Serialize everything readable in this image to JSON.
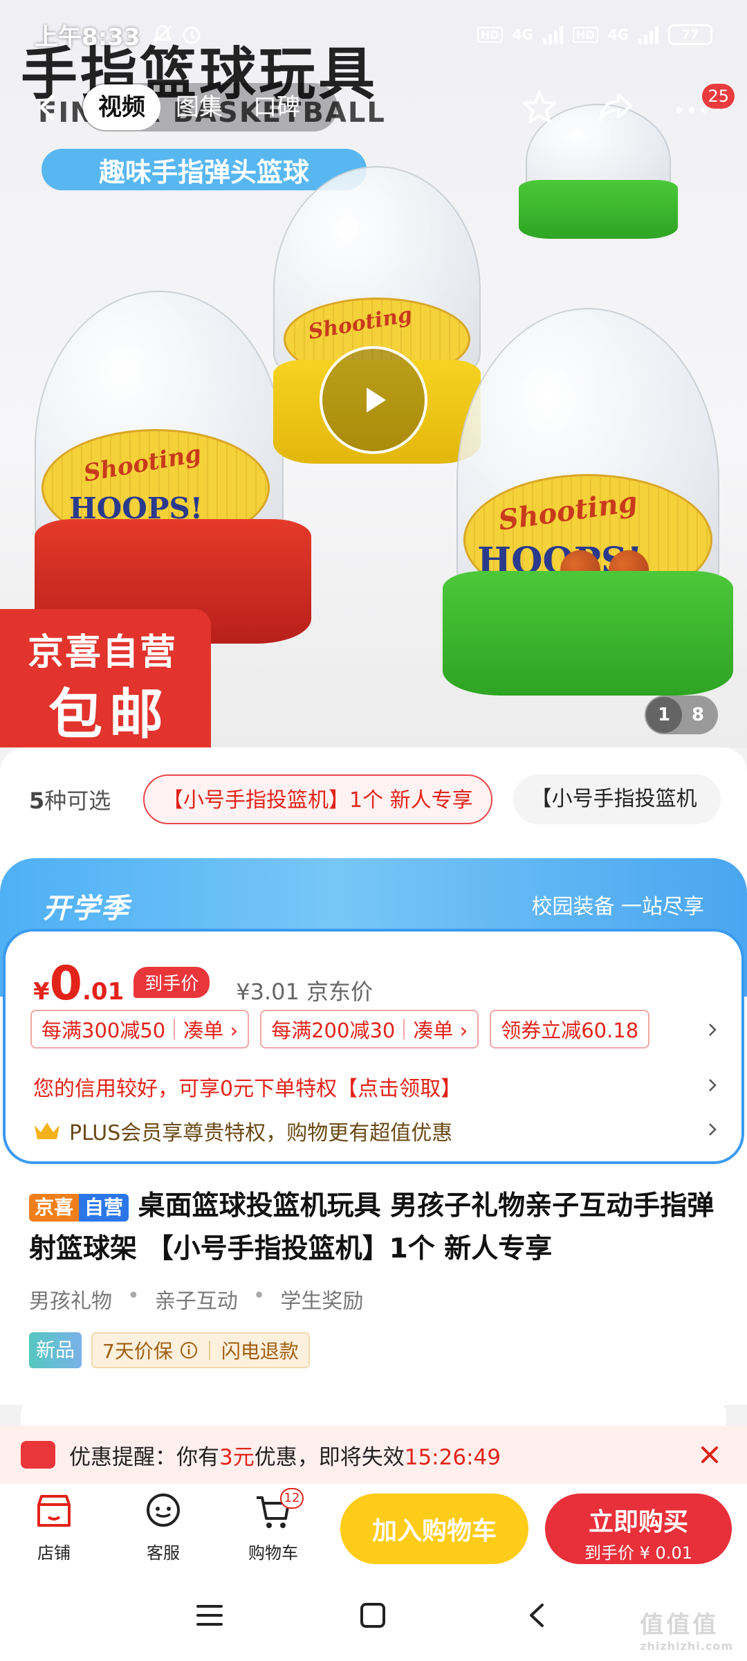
{
  "status_bar": {
    "time": "上午8:33",
    "network_1": "4G",
    "network_2": "4G",
    "hd": "HD",
    "battery": "77"
  },
  "nav": {
    "tabs": [
      {
        "label": "视频",
        "active": true
      },
      {
        "label": "图集",
        "active": false
      },
      {
        "label": "口碑",
        "active": false
      }
    ],
    "more_badge": "25"
  },
  "hero": {
    "banner_title": "手指篮球玩具",
    "banner_sub": "FINGER BASKETBALL",
    "banner_pill": "趣味手指弹头篮球",
    "toy_text_1": "Shooting",
    "toy_text_2": "HOOPS!",
    "promo_line1": "京喜自营",
    "promo_line2": "包邮",
    "pager_current": "1",
    "pager_total": "8"
  },
  "variants": {
    "count_num": "5",
    "count_text": "种可选",
    "selected": "【小号手指投篮机】1个 新人专享",
    "other": "【小号手指投篮机"
  },
  "promo": {
    "campaign": "开学季",
    "campaign_sub": "校园装备 一站尽享",
    "currency": "¥",
    "price_int": "0",
    "price_dec": ".01",
    "price_tag": "到手价",
    "jd_price": "¥3.01 京东价",
    "coupons": [
      {
        "text": "每满300减50",
        "action": "凑单 ›"
      },
      {
        "text": "每满200减30",
        "action": "凑单 ›"
      },
      {
        "text": "领券立减60.18",
        "action": ""
      }
    ],
    "credit": "您的信用较好，可享0元下单特权【点击领取】",
    "plus": "PLUS会员享尊贵特权，购物更有超值优惠"
  },
  "product": {
    "tag_a": "京喜",
    "tag_b": "自营",
    "title": "桌面篮球投篮机玩具 男孩子礼物亲子互动手指弹射篮球架 【小号手指投篮机】1个 新人专享",
    "keywords": [
      "男孩礼物",
      "亲子互动",
      "学生奖励"
    ],
    "tag_new": "新品",
    "guarantee": "7天价保",
    "refund": "闪电退款"
  },
  "reminder": {
    "prefix": "优惠提醒：你有",
    "amount": "3元",
    "middle": "优惠，即将失效",
    "countdown": "15:26:49"
  },
  "bottom_bar": {
    "shop": "店铺",
    "service": "客服",
    "cart": "购物车",
    "cart_count": "12",
    "add_cart": "加入购物车",
    "buy_now": "立即购买",
    "buy_sub": "到手价 ¥ 0.01"
  },
  "watermark": {
    "main": "值值值",
    "sub": "zhizhizhi.com"
  },
  "colors": {
    "accent_red": "#e2231a",
    "accent_yellow": "#ffcc1a",
    "campaign_blue": "#4fb0f5"
  }
}
